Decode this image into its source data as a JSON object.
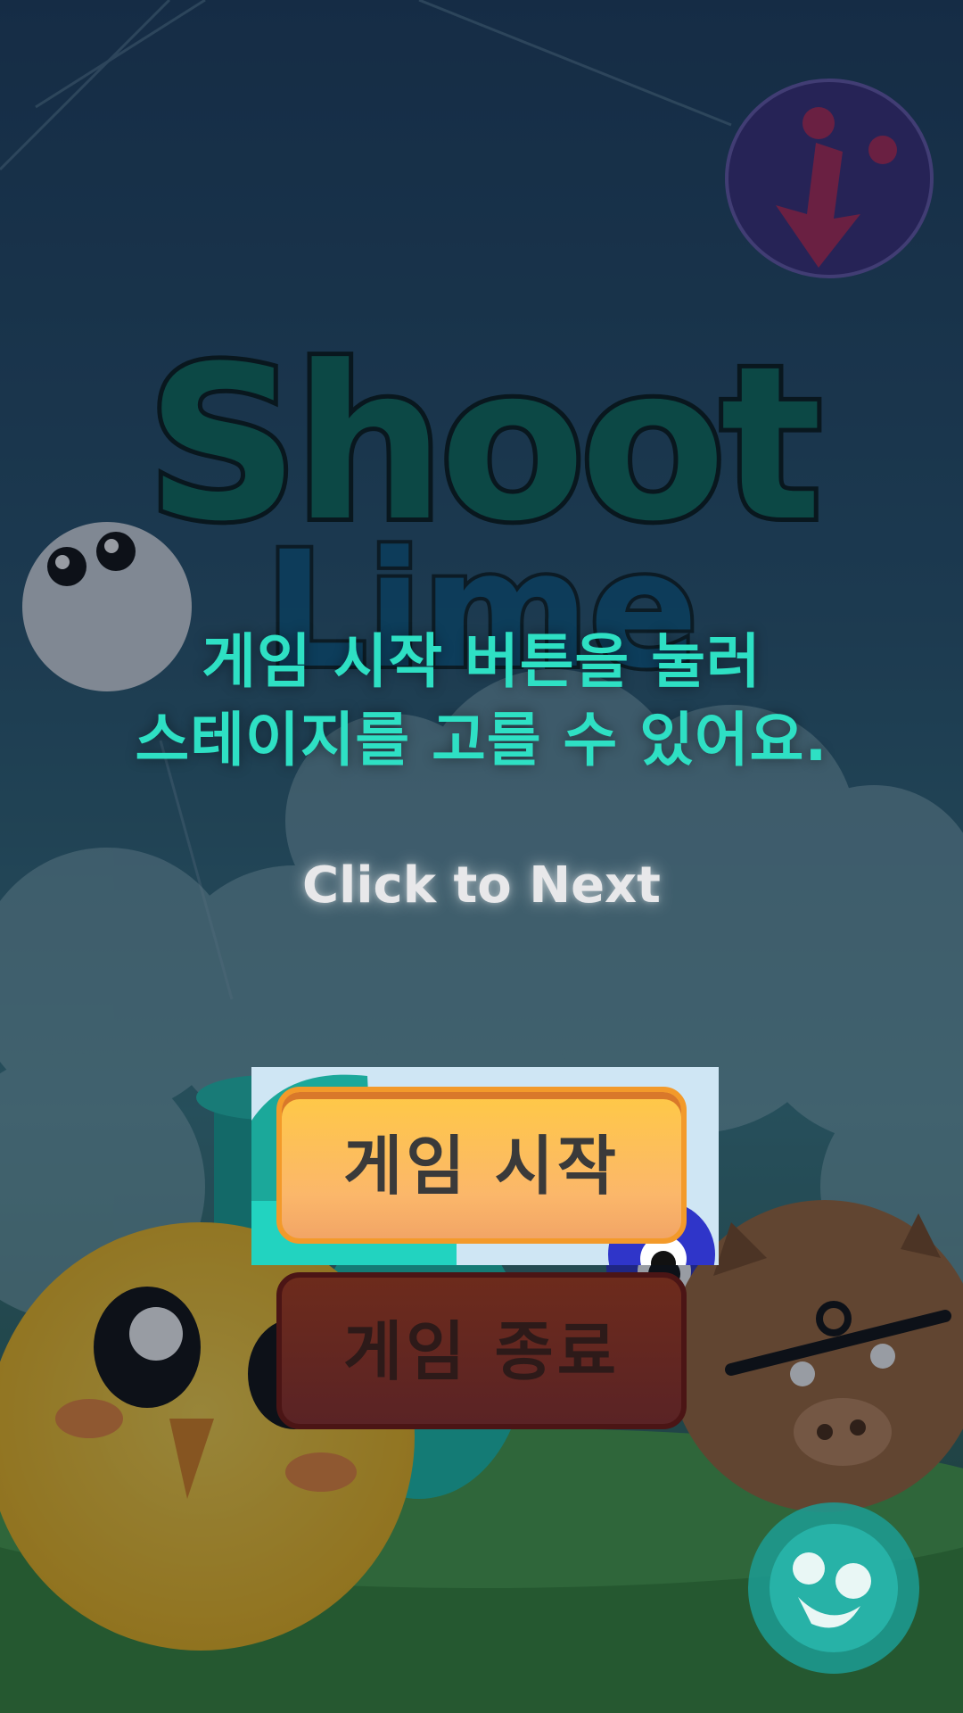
{
  "game": {
    "logo_word_1": "Shoot",
    "logo_word_2": "Lime"
  },
  "tutorial": {
    "line_1": "게임 시작 버튼을 눌러",
    "line_2": "스테이지를 고를 수 있어요."
  },
  "prompt": {
    "click_next": "Click to Next"
  },
  "menu": {
    "start_label": "게임 시작",
    "exit_label": "게임 종료"
  },
  "colors": {
    "tutorial_text": "#2ee0c4",
    "start_button": "#ffc946",
    "exit_button": "#6d2b1c"
  },
  "icons": {
    "info_badge": "download-arrow-icon",
    "sound_button": "sound-icon"
  }
}
